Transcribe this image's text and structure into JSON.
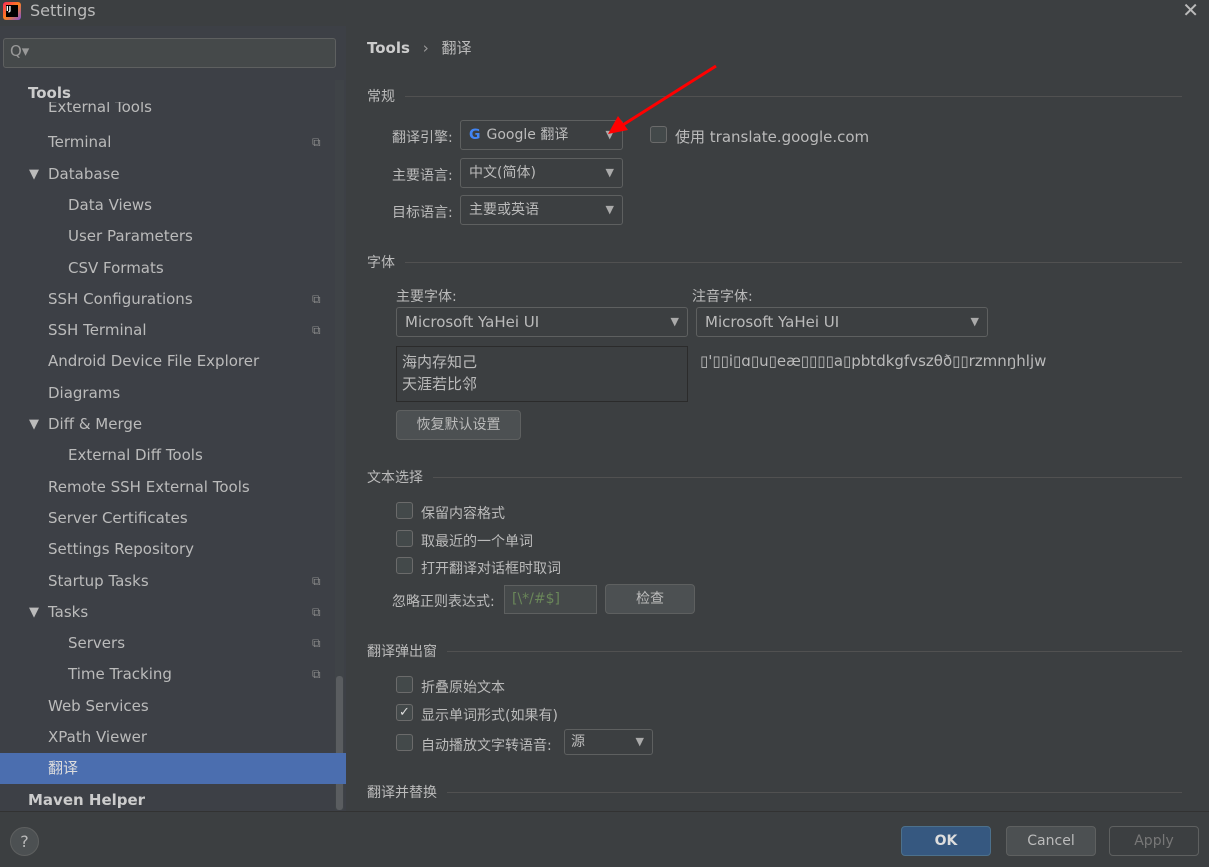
{
  "window": {
    "title": "Settings",
    "close": "✕"
  },
  "search": {
    "icon": "search-icon",
    "glyph": "Q▾",
    "placeholder": ""
  },
  "sidebar": {
    "header": "Tools",
    "items": [
      {
        "label": "External Tools",
        "indent": 1
      },
      {
        "label": "Terminal",
        "indent": 1,
        "copy": true
      },
      {
        "label": "Database",
        "indent": 1,
        "expanded": true
      },
      {
        "label": "Data Views",
        "indent": 2
      },
      {
        "label": "User Parameters",
        "indent": 2
      },
      {
        "label": "CSV Formats",
        "indent": 2
      },
      {
        "label": "SSH Configurations",
        "indent": 1,
        "copy": true
      },
      {
        "label": "SSH Terminal",
        "indent": 1,
        "copy": true
      },
      {
        "label": "Android Device File Explorer",
        "indent": 1
      },
      {
        "label": "Diagrams",
        "indent": 1
      },
      {
        "label": "Diff & Merge",
        "indent": 1,
        "expanded": true
      },
      {
        "label": "External Diff Tools",
        "indent": 2
      },
      {
        "label": "Remote SSH External Tools",
        "indent": 1
      },
      {
        "label": "Server Certificates",
        "indent": 1
      },
      {
        "label": "Settings Repository",
        "indent": 1
      },
      {
        "label": "Startup Tasks",
        "indent": 1,
        "copy": true
      },
      {
        "label": "Tasks",
        "indent": 1,
        "expanded": true,
        "copy": true
      },
      {
        "label": "Servers",
        "indent": 2,
        "copy": true
      },
      {
        "label": "Time Tracking",
        "indent": 2,
        "copy": true
      },
      {
        "label": "Web Services",
        "indent": 1
      },
      {
        "label": "XPath Viewer",
        "indent": 1
      },
      {
        "label": "翻译",
        "indent": 1,
        "selected": true
      },
      {
        "label": "Maven Helper",
        "indent": 0,
        "bold": true
      }
    ]
  },
  "breadcrumb": {
    "root": "Tools",
    "sep": "›",
    "current": "翻译"
  },
  "general": {
    "title": "常规",
    "engine_label": "翻译引擎:",
    "engine_value": "Google 翻译",
    "use_google_label": "使用 translate.google.com",
    "use_google_checked": false,
    "primary_lang_label": "主要语言:",
    "primary_lang_value": "中文(简体)",
    "target_lang_label": "目标语言:",
    "target_lang_value": "主要或英语"
  },
  "font": {
    "title": "字体",
    "primary_label": "主要字体:",
    "primary_value": "Microsoft YaHei UI",
    "phonetic_label": "注音字体:",
    "phonetic_value": "Microsoft YaHei UI",
    "preview_line1": "海内存知己",
    "preview_line2": "天涯若比邻",
    "phonetic_preview": "▯'▯▯i▯ɑ▯u▯eæ▯▯▯▯a▯pbtdkgfvszθð▯▯rzmnŋhljw",
    "reset_button": "恢复默认设置"
  },
  "selection": {
    "title": "文本选择",
    "options": [
      {
        "label": "保留内容格式",
        "checked": false
      },
      {
        "label": "取最近的一个单词",
        "checked": false
      },
      {
        "label": "打开翻译对话框时取词",
        "checked": false
      }
    ],
    "regex_label": "忽略正则表达式:",
    "regex_value": "[\\*/#$]",
    "check_button": "检查"
  },
  "popup": {
    "title": "翻译弹出窗",
    "options": [
      {
        "label": "折叠原始文本",
        "checked": false
      },
      {
        "label": "显示单词形式(如果有)",
        "checked": true
      }
    ],
    "tts_label": "自动播放文字转语音:",
    "tts_checked": false,
    "tts_value": "源"
  },
  "replace": {
    "title": "翻译并替换"
  },
  "footer": {
    "help": "?",
    "ok": "OK",
    "cancel": "Cancel",
    "apply": "Apply"
  },
  "colors": {
    "accent": "#4b6eaf",
    "ok": "#365880",
    "annotation_arrow": "#ff0000"
  }
}
